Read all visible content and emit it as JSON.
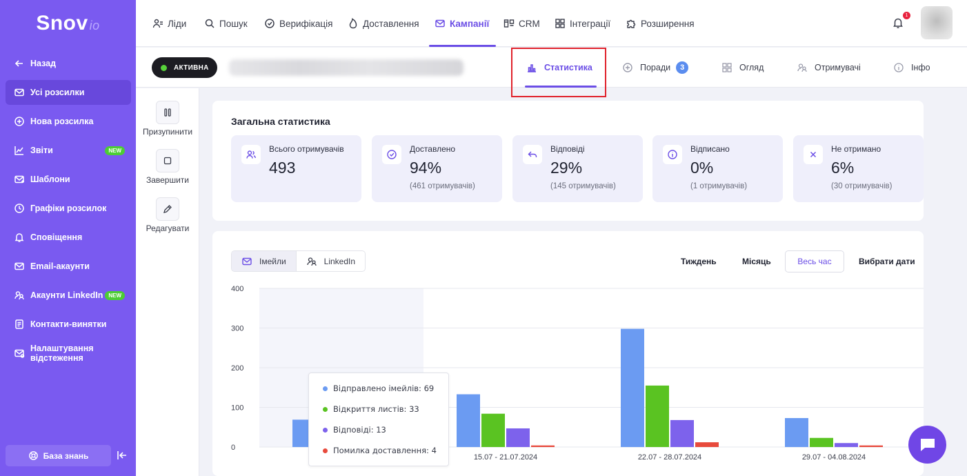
{
  "brand": {
    "name": "Snov",
    "suffix": "io"
  },
  "sidebar": {
    "items": [
      {
        "label": "Назад",
        "icon": "arrow-left-icon"
      },
      {
        "label": "Усі розсилки",
        "icon": "mail-icon",
        "active": true
      },
      {
        "label": "Нова розсилка",
        "icon": "plus-circle-icon"
      },
      {
        "label": "Звіти",
        "icon": "chart-icon",
        "badge": "NEW"
      },
      {
        "label": "Шаблони",
        "icon": "template-icon"
      },
      {
        "label": "Графіки розсилок",
        "icon": "clock-icon"
      },
      {
        "label": "Сповіщення",
        "icon": "bell-icon"
      },
      {
        "label": "Email-акаунти",
        "icon": "mail-icon"
      },
      {
        "label": "Акаунти LinkedIn",
        "icon": "users-icon",
        "badge": "NEW"
      },
      {
        "label": "Контакти-винятки",
        "icon": "document-icon"
      },
      {
        "label": "Налаштування відстеження",
        "icon": "mail-track-icon"
      }
    ],
    "knowledge_base": "База знань"
  },
  "topnav": {
    "items": [
      {
        "label": "Ліди",
        "icon": "leads-icon"
      },
      {
        "label": "Пошук",
        "icon": "search-icon"
      },
      {
        "label": "Верифікація",
        "icon": "check-circle-icon"
      },
      {
        "label": "Доставлення",
        "icon": "flame-icon"
      },
      {
        "label": "Кампанії",
        "icon": "mail-icon",
        "active": true
      },
      {
        "label": "CRM",
        "icon": "crm-icon"
      },
      {
        "label": "Інтеграції",
        "icon": "grid-icon"
      },
      {
        "label": "Розширення",
        "icon": "puzzle-icon"
      }
    ],
    "notifications": "1"
  },
  "campaign": {
    "status": "АКТИВНА",
    "tabs": [
      {
        "label": "Статистика",
        "icon": "bar-chart-icon",
        "active": true
      },
      {
        "label": "Поради",
        "icon": "plus-circle-icon",
        "count": "3"
      },
      {
        "label": "Огляд",
        "icon": "grid-icon"
      },
      {
        "label": "Отримувачі",
        "icon": "users-icon"
      },
      {
        "label": "Інфо",
        "icon": "info-icon"
      }
    ],
    "actions": [
      {
        "label": "Призупинити",
        "icon": "pause-icon"
      },
      {
        "label": "Завершити",
        "icon": "stop-icon"
      },
      {
        "label": "Редагувати",
        "icon": "pencil-icon"
      }
    ]
  },
  "stats": {
    "title": "Загальна статистика",
    "cards": [
      {
        "label": "Всього отримувачів",
        "value": "493",
        "sub": "",
        "icon": "users-icon"
      },
      {
        "label": "Доставлено",
        "value": "94%",
        "sub": "(461 отримувачів)",
        "icon": "check-circle-icon"
      },
      {
        "label": "Відповіді",
        "value": "29%",
        "sub": "(145 отримувачів)",
        "icon": "reply-icon"
      },
      {
        "label": "Відписано",
        "value": "0%",
        "sub": "(1 отримувачів)",
        "icon": "info-icon"
      },
      {
        "label": "Не отримано",
        "value": "6%",
        "sub": "(30 отримувачів)",
        "icon": "close-icon"
      }
    ]
  },
  "chart_controls": {
    "channels": [
      {
        "label": "Імейли",
        "icon": "mail-icon",
        "active": true
      },
      {
        "label": "LinkedIn",
        "icon": "users-icon"
      }
    ],
    "ranges": [
      {
        "label": "Тиждень"
      },
      {
        "label": "Місяць"
      },
      {
        "label": "Весь час",
        "active": true
      },
      {
        "label": "Вибрати дати"
      }
    ]
  },
  "tooltip": {
    "rows": [
      {
        "text": "Відправлено імейлів: 69",
        "color": "#6b9bf2"
      },
      {
        "text": "Відкриття листів: 33",
        "color": "#5ac322"
      },
      {
        "text": "Відповіді: 13",
        "color": "#7d62ec"
      },
      {
        "text": "Помилка доставлення: 4",
        "color": "#e84a3c"
      }
    ]
  },
  "chart_data": {
    "type": "bar",
    "categories": [
      "",
      "15.07 - 21.07.2024",
      "22.07 - 28.07.2024",
      "29.07 - 04.08.2024"
    ],
    "series": [
      {
        "name": "Відправлено імейлів",
        "color": "#6b9bf2",
        "values": [
          69,
          133,
          298,
          73
        ]
      },
      {
        "name": "Відкриття листів",
        "color": "#5ac322",
        "values": [
          33,
          84,
          155,
          23
        ]
      },
      {
        "name": "Відповіді",
        "color": "#7d62ec",
        "values": [
          13,
          47,
          68,
          10
        ]
      },
      {
        "name": "Помилка доставлення",
        "color": "#e84a3c",
        "values": [
          4,
          4,
          12,
          4
        ]
      }
    ],
    "yticks": [
      0,
      100,
      200,
      300,
      400
    ],
    "ylim": [
      0,
      400
    ],
    "grid": true,
    "highlighted_category": 0
  }
}
